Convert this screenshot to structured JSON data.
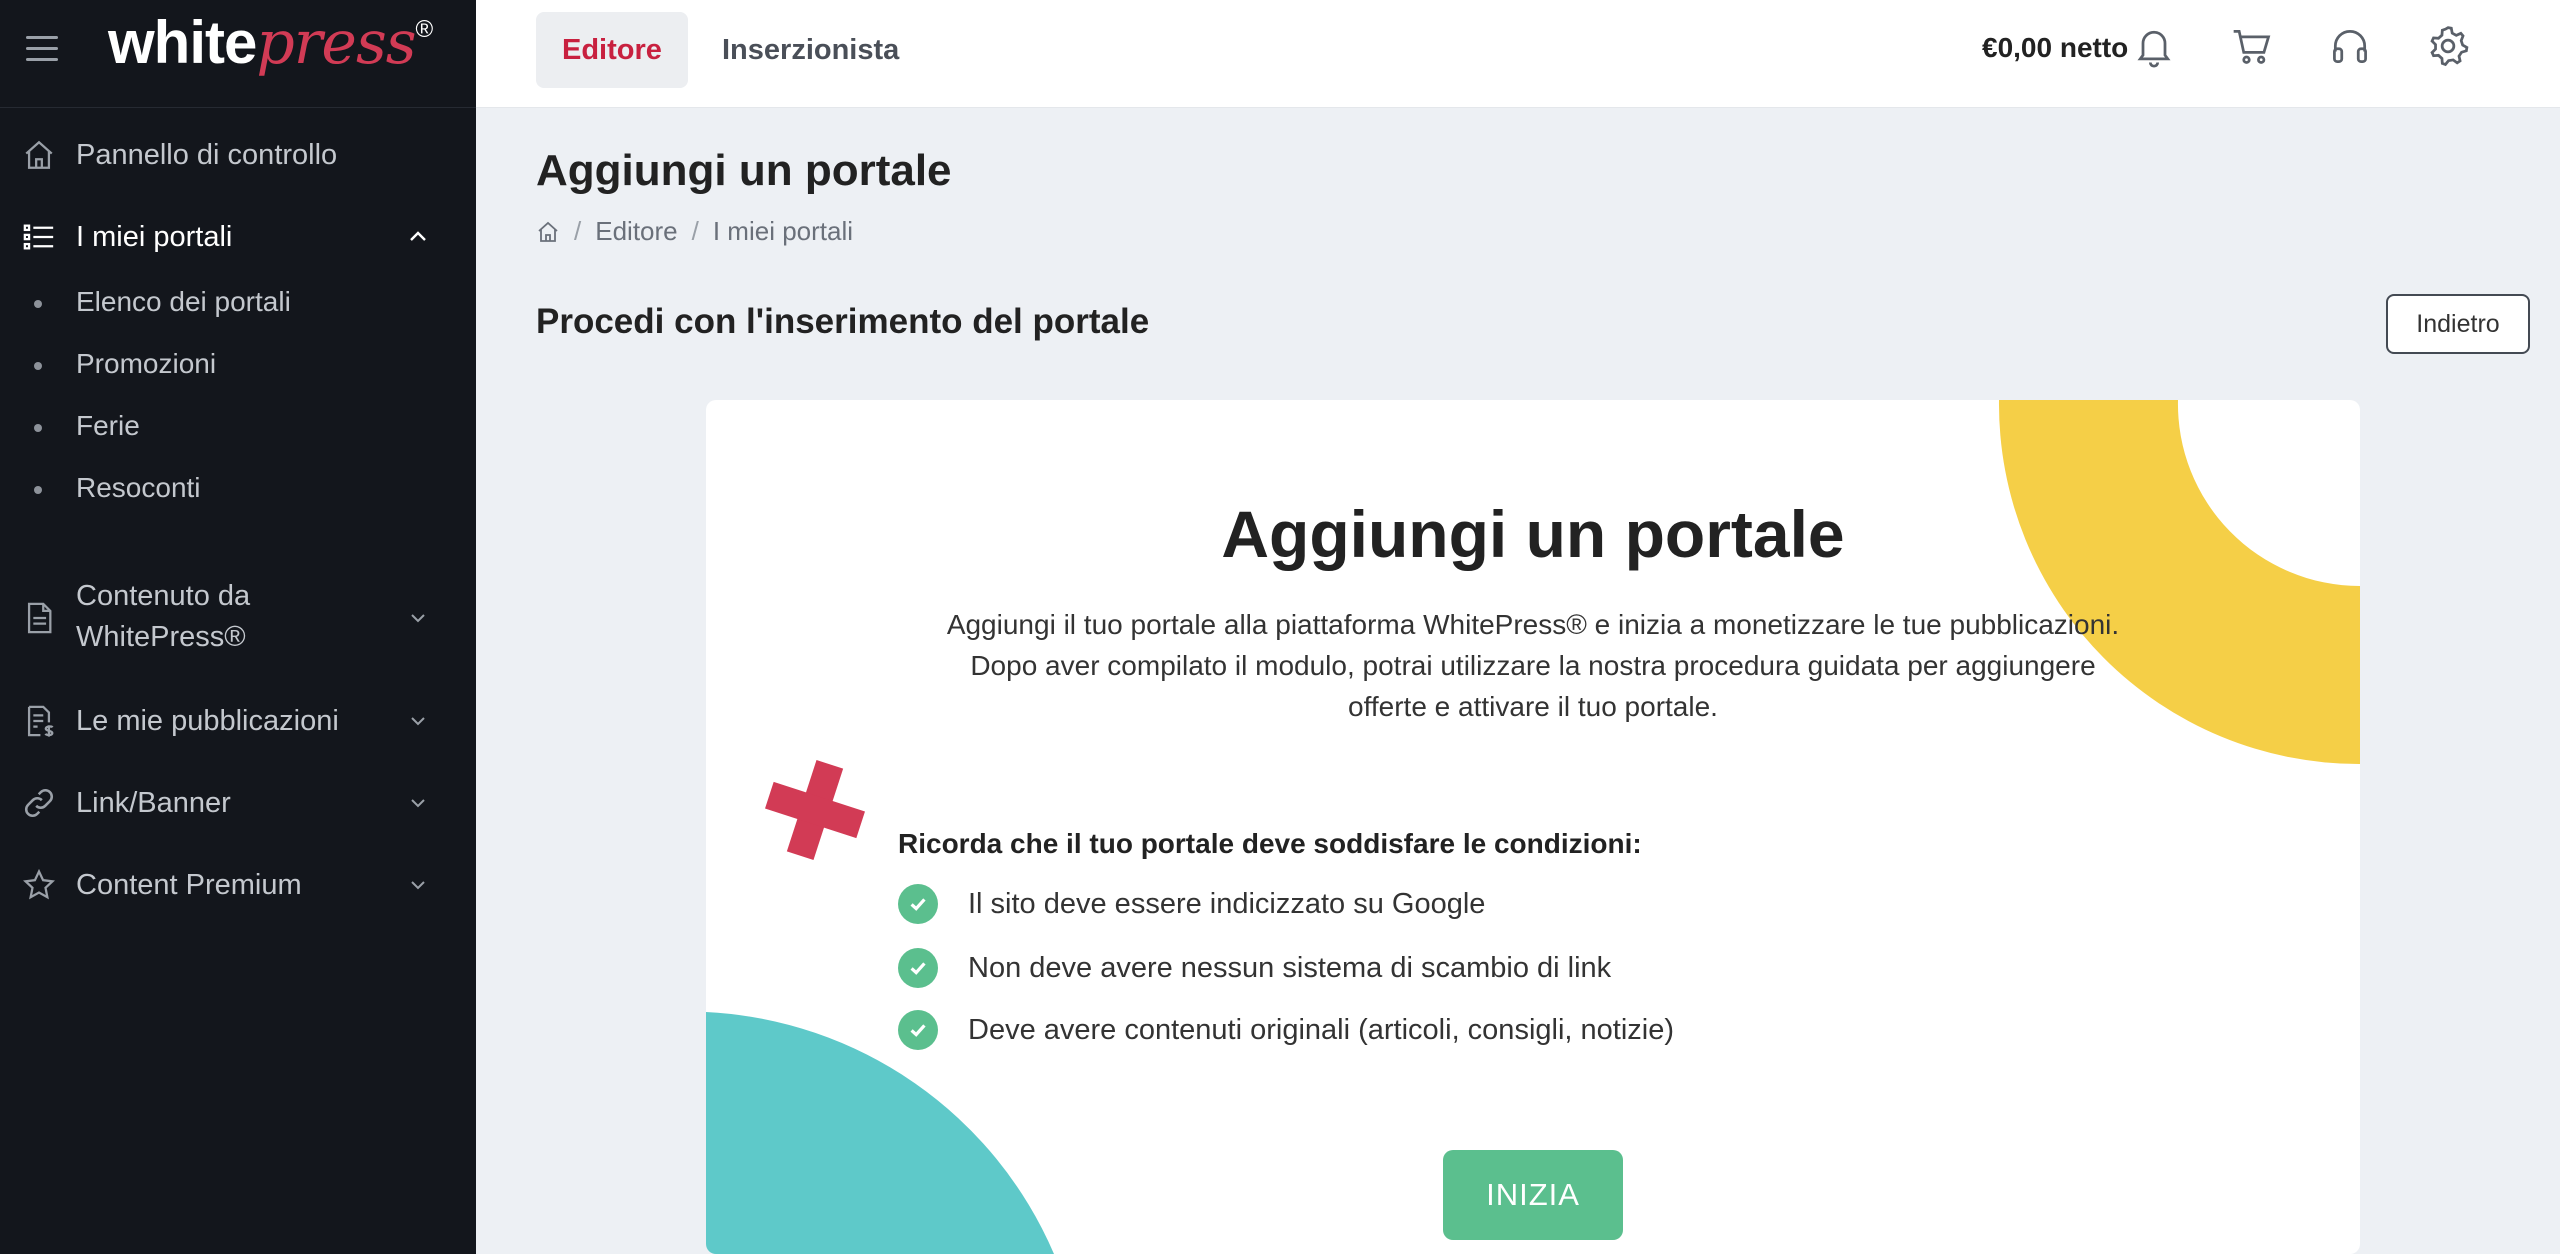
{
  "app": {
    "logo_main": "white",
    "logo_accent": "press",
    "logo_reg": "®",
    "brand_color": "#d23b55"
  },
  "sidebar": {
    "items": [
      {
        "label": "Pannello di controllo",
        "icon": "home-icon"
      },
      {
        "label": "I miei portali",
        "icon": "list-icon",
        "expanded": true,
        "children": [
          "Elenco dei portali",
          "Promozioni",
          "Ferie",
          "Resoconti"
        ]
      },
      {
        "label_line1": "Contenuto da",
        "label_line2": "WhitePress®",
        "icon": "document-icon"
      },
      {
        "label": "Le mie pubblicazioni",
        "icon": "invoice-icon"
      },
      {
        "label": "Link/Banner",
        "icon": "link-icon"
      },
      {
        "label": "Content Premium",
        "icon": "star-icon"
      }
    ]
  },
  "topbar": {
    "tabs": [
      {
        "label": "Editore",
        "active": true
      },
      {
        "label": "Inserzionista",
        "active": false
      }
    ],
    "balance": "€0,00 netto",
    "icons": [
      "bell-icon",
      "cart-icon",
      "headset-icon",
      "gear-icon"
    ]
  },
  "main": {
    "page_title": "Aggiungi un portale",
    "breadcrumb": [
      "Editore",
      "I miei portali"
    ],
    "section_title": "Procedi con l'inserimento del portale",
    "back_button": "Indietro",
    "card": {
      "title": "Aggiungi un portale",
      "desc_line1": "Aggiungi il tuo portale alla piattaforma WhitePress® e inizia a monetizzare le tue pubblicazioni.",
      "desc_line2": "Dopo aver compilato il modulo, potrai utilizzare la nostra procedura guidata per aggiungere",
      "desc_line3": "offerte e attivare il tuo portale.",
      "conditions_title": "Ricorda che il tuo portale deve soddisfare le condizioni:",
      "conditions": [
        "Il sito deve essere indicizzato su Google",
        "Non deve avere nessun sistema di scambio di link",
        "Deve avere contenuti originali (articoli, consigli, notizie)"
      ],
      "start_button": "INIZIA",
      "colors": {
        "yellow": "#f5cf47",
        "teal": "#5ec9c9",
        "red": "#d23b55",
        "green": "#5bbf8e"
      }
    }
  }
}
